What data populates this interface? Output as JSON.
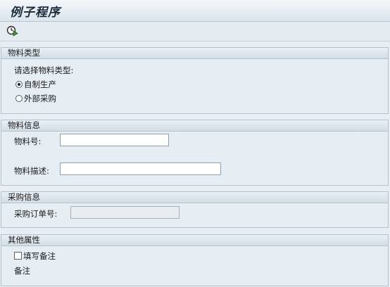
{
  "window": {
    "title": "例子程序"
  },
  "toolbar": {
    "execute_icon": "execute-clock-icon"
  },
  "material_type": {
    "header": "物料类型",
    "prompt": "请选择物料类型:",
    "options": [
      {
        "label": "自制生产",
        "selected": true
      },
      {
        "label": "外部采购",
        "selected": false
      }
    ]
  },
  "material_info": {
    "header": "物料信息",
    "number_label": "物料号:",
    "number_value": "",
    "desc_label": "物料描述:",
    "desc_value": ""
  },
  "purchase_info": {
    "header": "采购信息",
    "po_label": "采购订单号:",
    "po_value": ""
  },
  "other": {
    "header": "其他属性",
    "checkbox_label": "填写备注",
    "checked": false,
    "remark_label": "备注"
  }
}
